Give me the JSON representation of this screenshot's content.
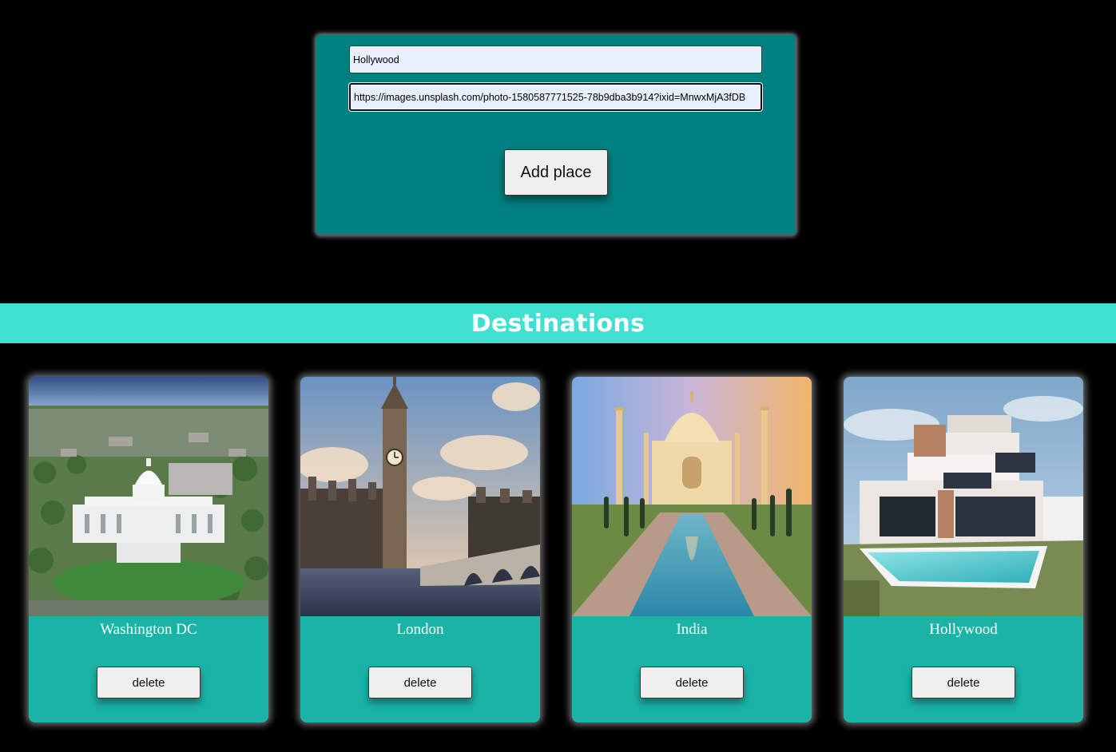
{
  "form": {
    "name_value": "Hollywood",
    "url_value": "https://images.unsplash.com/photo-1580587771525-78b9dba3b914?ixid=MnwxMjA3fDB",
    "add_button_label": "Add place"
  },
  "banner": {
    "title": "Destinations"
  },
  "cards": [
    {
      "title": "Washington DC",
      "delete_label": "delete",
      "image": "washington-capitol-aerial-photo"
    },
    {
      "title": "London",
      "delete_label": "delete",
      "image": "big-ben-westminster-photo"
    },
    {
      "title": "India",
      "delete_label": "delete",
      "image": "taj-mahal-photo"
    },
    {
      "title": "Hollywood",
      "delete_label": "delete",
      "image": "modern-house-pool-photo"
    }
  ],
  "colors": {
    "page_background": "#000000",
    "form_panel": "#008080",
    "banner": "#40e0d0",
    "card": "#1ab3a6",
    "button": "#efefef"
  }
}
